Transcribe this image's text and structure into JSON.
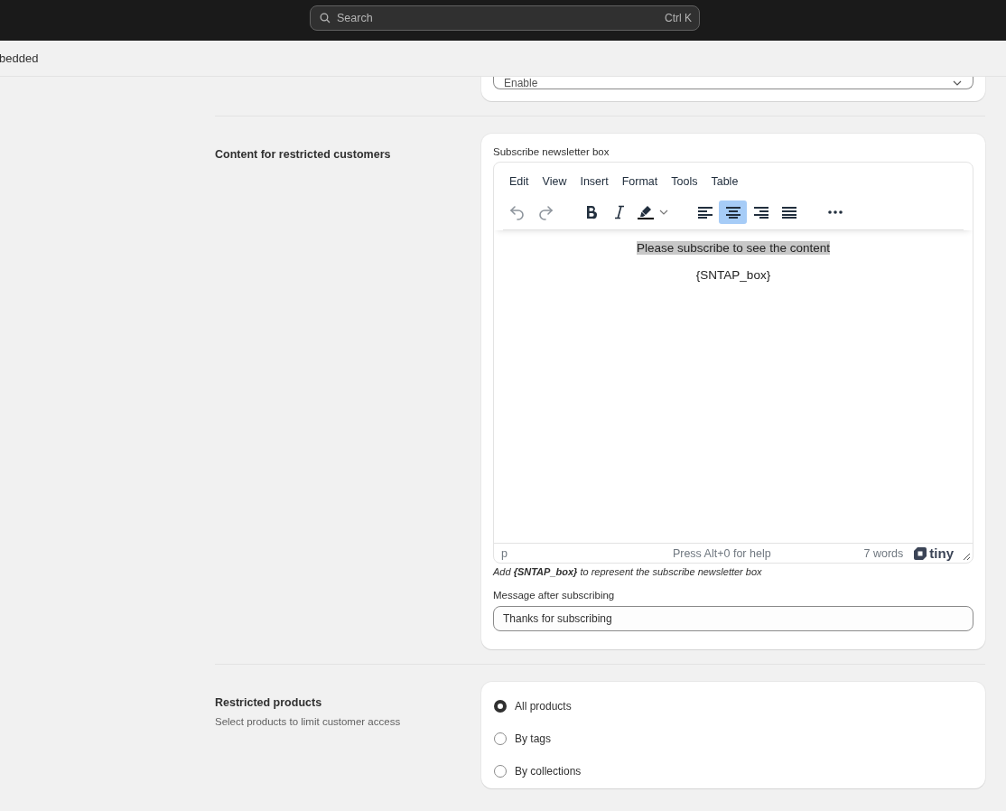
{
  "topbar": {
    "search": {
      "placeholder": "Search",
      "shortcut": "Ctrl K"
    }
  },
  "subheader": {
    "title": "bedded"
  },
  "display_card": {
    "select": {
      "value": "Enable"
    }
  },
  "restricted_content": {
    "title": "Content for restricted customers",
    "editor": {
      "label": "Subscribe newsletter box",
      "menu": [
        "Edit",
        "View",
        "Insert",
        "Format",
        "Tools",
        "Table"
      ],
      "toolbar": [
        [
          {
            "kind": "undo",
            "disabled": true,
            "selected": false
          },
          {
            "kind": "redo",
            "disabled": true,
            "selected": false
          }
        ],
        [
          {
            "kind": "bold",
            "disabled": false,
            "selected": false
          },
          {
            "kind": "italic",
            "disabled": false,
            "selected": false
          },
          {
            "kind": "highlight",
            "disabled": false,
            "selected": false
          }
        ],
        [
          {
            "kind": "align-left",
            "disabled": false,
            "selected": false
          },
          {
            "kind": "align-center",
            "disabled": false,
            "selected": true
          },
          {
            "kind": "align-right",
            "disabled": false,
            "selected": false
          },
          {
            "kind": "justify",
            "disabled": false,
            "selected": false
          }
        ],
        [
          {
            "kind": "more",
            "disabled": false,
            "selected": false
          }
        ]
      ],
      "paragraphs": [
        {
          "text": "Please subscribe to see the content",
          "highlighted": true
        },
        {
          "text": "{SNTAP_box}",
          "highlighted": false
        }
      ],
      "status": {
        "path": "p",
        "help": "Press Alt+0 for help",
        "word_count": "7 words",
        "brand": "tiny"
      }
    },
    "hint": "Add **{SNTAP_box}** to represent the subscribe newsletter box",
    "message": {
      "label": "Message after subscribing",
      "value": "Thanks for subscribing"
    }
  },
  "restricted_products": {
    "title": "Restricted products",
    "description": "Select products to limit customer access",
    "options": [
      {
        "label": "All products",
        "selected": true
      },
      {
        "label": "By tags",
        "selected": false
      },
      {
        "label": "By collections",
        "selected": false
      }
    ]
  }
}
